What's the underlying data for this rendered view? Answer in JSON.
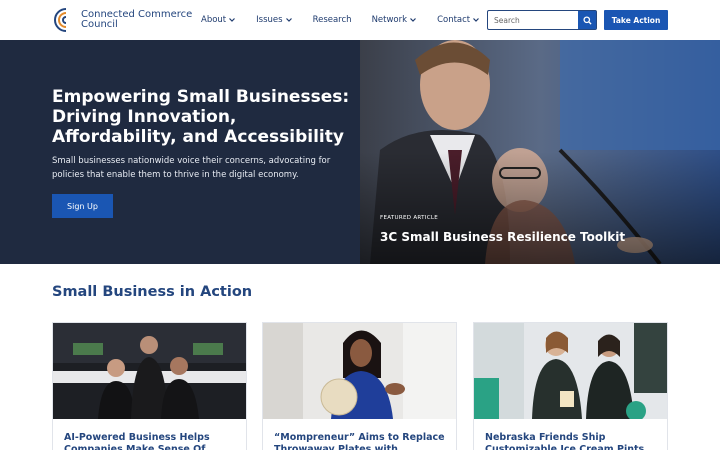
{
  "header": {
    "logo_line1": "Connected Commerce",
    "logo_line2": "Council",
    "nav": [
      {
        "label": "About",
        "dropdown": true
      },
      {
        "label": "Issues",
        "dropdown": true
      },
      {
        "label": "Research",
        "dropdown": false
      },
      {
        "label": "Network",
        "dropdown": true
      },
      {
        "label": "Contact",
        "dropdown": true
      }
    ],
    "search_placeholder": "Search",
    "take_action": "Take Action"
  },
  "hero": {
    "title": "Empowering Small Businesses: Driving Innovation, Affordability, and Accessibility",
    "subtitle": "Small businesses nationwide voice their concerns, advocating for policies that enable them to thrive in the digital economy.",
    "signup": "Sign Up",
    "featured_label": "FEATURED ARTICLE",
    "featured_title": "3C Small Business Resilience Toolkit"
  },
  "section": {
    "title": "Small Business in Action",
    "cards": [
      {
        "title": "AI-Powered Business Helps Companies Make Sense Of"
      },
      {
        "title": "“Mompreneur” Aims to Replace Throwaway Plates with"
      },
      {
        "title": "Nebraska Friends Ship Customizable Ice Cream Pints"
      }
    ]
  },
  "colors": {
    "brand_blue": "#1a56b3",
    "navy_text": "#24467e",
    "hero_dark": "#1f2a40",
    "logo_orange": "#e38b2c"
  }
}
